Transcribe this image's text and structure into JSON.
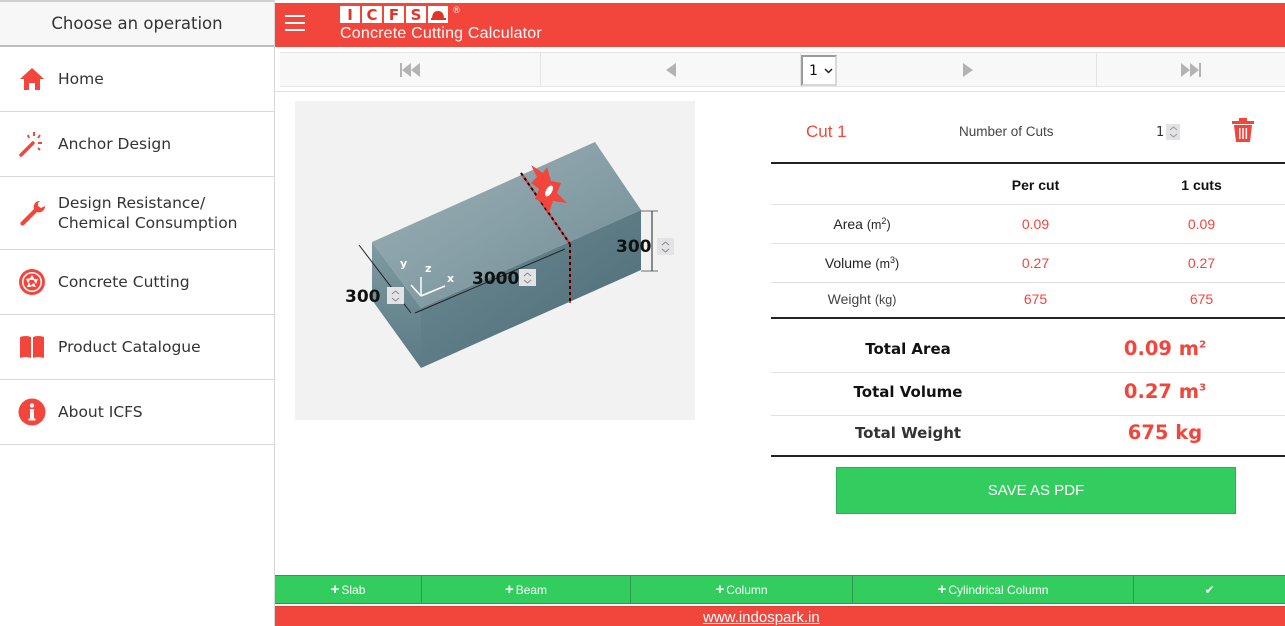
{
  "sidebar": {
    "header": "Choose an operation",
    "items": [
      {
        "label": "Home",
        "icon": "home-icon"
      },
      {
        "label": "Anchor Design",
        "icon": "magic-wand-icon"
      },
      {
        "label_line1": "Design Resistance/",
        "label_line2": "Chemical Consumption",
        "icon": "wrench-icon"
      },
      {
        "label": "Concrete Cutting",
        "icon": "aperture-icon"
      },
      {
        "label": "Product Catalogue",
        "icon": "book-icon"
      },
      {
        "label": "About ICFS",
        "icon": "info-icon"
      }
    ]
  },
  "header": {
    "logo_letters": [
      "I",
      "C",
      "F",
      "S"
    ],
    "logo_reg": "®",
    "title": "Concrete Cutting Calculator",
    "menu_icon": "hamburger-icon"
  },
  "pager": {
    "first_icon": "first-page-icon",
    "prev_icon": "prev-page-icon",
    "selected_page": "1",
    "next_icon": "next-page-icon",
    "last_icon": "last-page-icon"
  },
  "figure": {
    "width_value": "300",
    "length_value": "3000",
    "height_value": "300",
    "axis_x": "x",
    "axis_y": "y",
    "axis_z": "z"
  },
  "cut": {
    "title": "Cut 1",
    "num_cuts_label": "Number of Cuts",
    "num_cuts_value": "1",
    "delete_icon": "trash-icon"
  },
  "table": {
    "headers": [
      "",
      "Per cut",
      "1 cuts"
    ],
    "rows": [
      {
        "label": "Area",
        "unit": "(m",
        "sup": "2",
        "unit_end": ")",
        "per_cut": "0.09",
        "total": "0.09"
      },
      {
        "label": "Volume",
        "unit": "(m",
        "sup": "3",
        "unit_end": ")",
        "per_cut": "0.27",
        "total": "0.27"
      },
      {
        "label": "Weight",
        "unit": "(kg)",
        "sup": "",
        "unit_end": "",
        "per_cut": "675",
        "total": "675"
      }
    ]
  },
  "totals": [
    {
      "label": "Total Area",
      "value": "0.09 m",
      "sup": "2"
    },
    {
      "label": "Total Volume",
      "value": "0.27 m",
      "sup": "3"
    },
    {
      "label": "Total Weight",
      "value": "675 kg",
      "sup": ""
    }
  ],
  "save_button": "SAVE AS PDF",
  "add_bar": {
    "buttons": [
      "Slab",
      "Beam",
      "Column",
      "Cylindrical Column"
    ],
    "plus": "+",
    "confirm": "✔"
  },
  "footer": {
    "link": "www.indospark.in"
  },
  "colors": {
    "brand_red": "#f2463d",
    "action_green": "#33cc5f"
  }
}
